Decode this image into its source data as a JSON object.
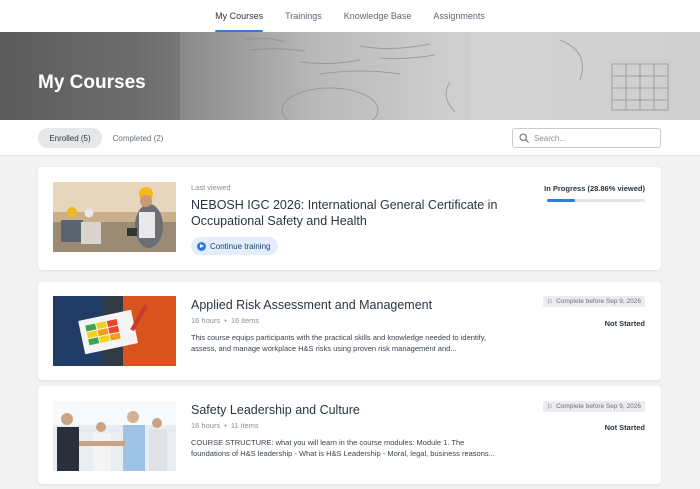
{
  "nav": {
    "tabs": [
      {
        "label": "My Courses"
      },
      {
        "label": "Trainings"
      },
      {
        "label": "Knowledge Base"
      },
      {
        "label": "Assignments"
      }
    ],
    "active_tab": "My Courses"
  },
  "hero": {
    "title": "My Courses"
  },
  "filters": {
    "enrolled_label": "Enrolled (5)",
    "completed_label": "Completed (2)",
    "search_placeholder": "Search..."
  },
  "courses": [
    {
      "last_viewed": "Last viewed",
      "title": "NEBOSH IGC 2026: International General Certificate in Occupational Safety and Health",
      "continue_label": "Continue training",
      "status": "In Progress (28.86% viewed)",
      "progress": 0.2886
    },
    {
      "title": "Applied Risk Assessment and Management",
      "hours": "16 hours",
      "items": "16 items",
      "description": "This course equips participants with the practical skills and knowledge needed to identify, assess, and manage workplace H&S risks using proven risk management and...",
      "due": "Complete before Sep 9, 2026",
      "status": "Not Started"
    },
    {
      "title": "Safety Leadership and Culture",
      "hours": "16 hours",
      "items": "11 items",
      "description": "COURSE STRUCTURE: what you will learn in the course modules: Module 1. The foundations of H&S leadership - What is H&S Leadership - Moral, legal, business reasons...",
      "due": "Complete before Sep 9, 2026",
      "status": "Not Started"
    }
  ],
  "colors": {
    "accent": "#2c7be5",
    "text": "#2d3440",
    "muted": "#8a9099"
  },
  "separator": "•"
}
